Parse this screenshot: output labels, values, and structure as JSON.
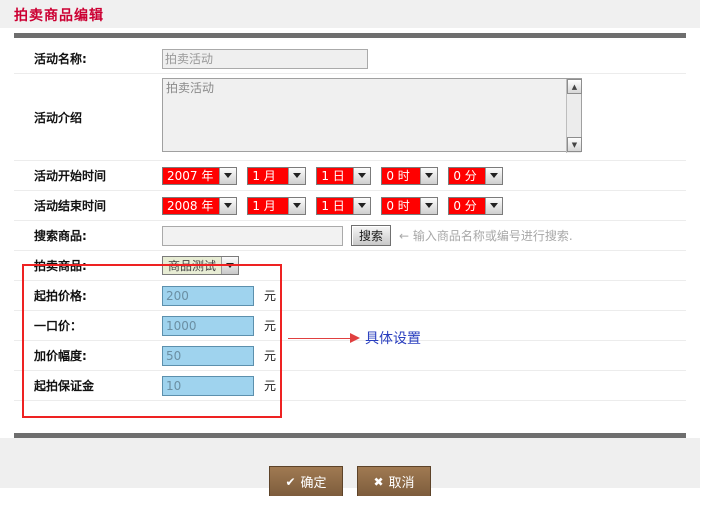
{
  "header": {
    "title": "拍卖商品编辑"
  },
  "form": {
    "rows": [
      {
        "label": "活动名称:",
        "type": "text",
        "value": "拍卖活动"
      },
      {
        "label": "活动介绍",
        "type": "textarea",
        "value": "拍卖活动"
      },
      {
        "label": "活动开始时间",
        "type": "date"
      },
      {
        "label": "活动结束时间",
        "type": "date"
      },
      {
        "label": "搜索商品:",
        "type": "search"
      },
      {
        "label": "拍卖商品:",
        "type": "select"
      },
      {
        "label": "起拍价格:",
        "type": "money",
        "value": "200"
      },
      {
        "label": "一口价：",
        "type": "money",
        "value": "1000"
      },
      {
        "label": "加价幅度:",
        "type": "money",
        "value": "50"
      },
      {
        "label": "起拍保证金",
        "type": "money",
        "value": "10"
      }
    ],
    "name_label": "活动名称:",
    "name_value": "拍卖活动",
    "intro_label": "活动介绍",
    "intro_value": "拍卖活动",
    "start_label": "活动开始时间",
    "end_label": "活动结束时间",
    "search_label": "搜索商品:",
    "search_value": "",
    "search_placeholder": "",
    "search_button": "搜索",
    "search_hint": "← 输入商品名称或编号进行搜索.",
    "product_label": "拍卖商品:",
    "product_value": "商品测试",
    "start_price_label": "起拍价格:",
    "start_price_value": "200",
    "buyout_label": "一口价：",
    "buyout_value": "1000",
    "increment_label": "加价幅度:",
    "increment_value": "50",
    "deposit_label": "起拍保证金",
    "deposit_value": "10",
    "unit": "元"
  },
  "start_time": {
    "year": "2007 年",
    "month": "1 月",
    "day": "1 日",
    "hour": "0 时",
    "minute": "0 分"
  },
  "end_time": {
    "year": "2008 年",
    "month": "1 月",
    "day": "1 日",
    "hour": "0 时",
    "minute": "0 分"
  },
  "annotation": {
    "text": "具体设置"
  },
  "footer": {
    "confirm_label": "确定",
    "confirm_glyph": "✔",
    "cancel_label": "取消",
    "cancel_glyph": "✖"
  },
  "colors": {
    "title": "#cc0033",
    "date_select_bg": "#ff0000",
    "money_input_bg": "#9fd3ee",
    "highlight_border": "#ee2222",
    "annotation_arrow": "#e04040",
    "annotation_text": "#2a3fbf",
    "button_brown": "#8a6542"
  }
}
